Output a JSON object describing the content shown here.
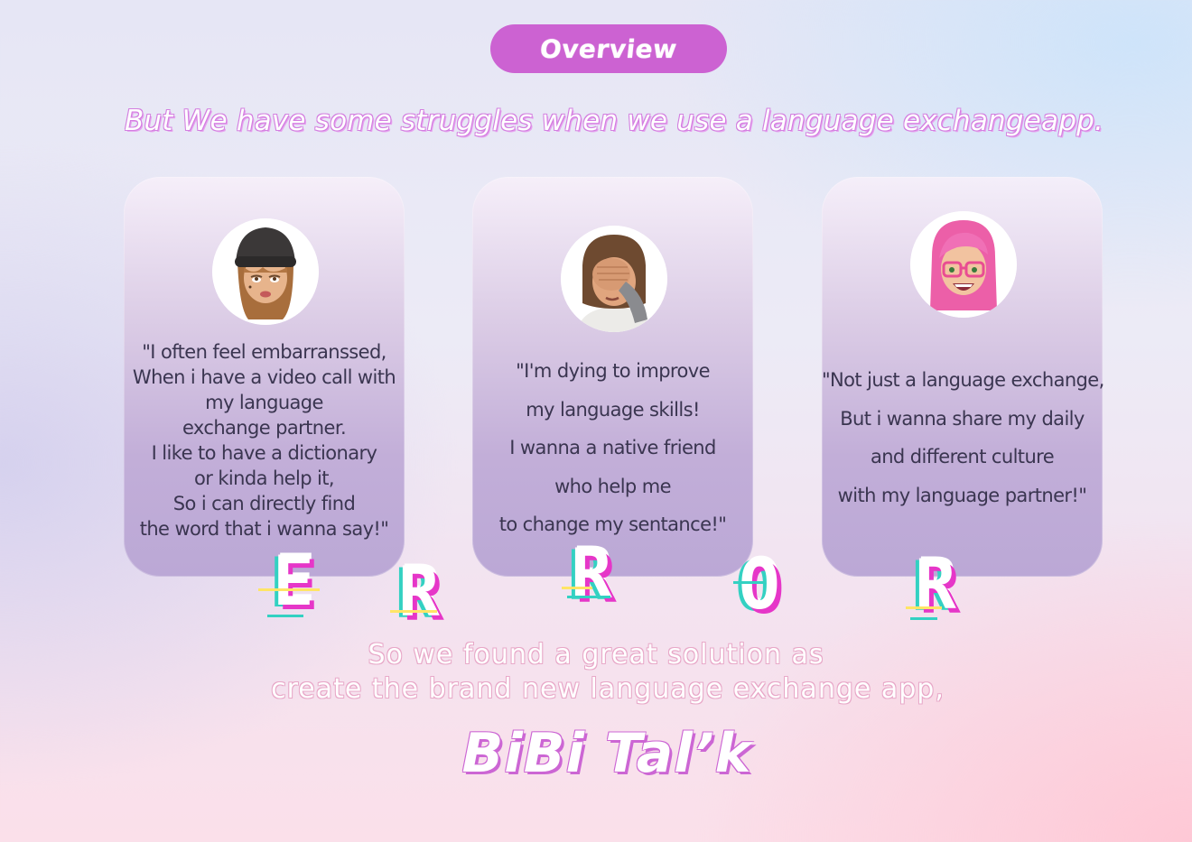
{
  "header": {
    "pill_label": "Overview",
    "headline": "But We have some struggles when we use a language exchangeapp."
  },
  "cards": [
    {
      "avatar_icon": "memoji-beanie-girl-icon",
      "quote_lines": [
        "\"I often feel embarranssed,",
        "When i have a video call with",
        "my language",
        "exchange partner.",
        "I like to have a dictionary",
        "or kinda help it,",
        "So i can directly find",
        "the word that i  wanna say!\""
      ]
    },
    {
      "avatar_icon": "memoji-facepalm-icon",
      "quote_lines": [
        "\"I'm dying to improve",
        "my language skills!",
        "I wanna a native friend",
        "who help me",
        "to change my sentance!\""
      ]
    },
    {
      "avatar_icon": "memoji-pink-hair-glasses-icon",
      "quote_lines": [
        "\"Not just a language exchange,",
        "But i wanna share my daily",
        "and different culture",
        "with my language partner!\""
      ]
    }
  ],
  "error_letters": [
    "E",
    "R",
    "R",
    "O",
    "R"
  ],
  "solution": {
    "line1": "So we found a great solution as",
    "line2": "create the brand new language exchange app,",
    "brand": "BiBi Tal’k"
  },
  "colors": {
    "pill": "#cc62d2",
    "glitch_magenta": "#e636c8",
    "glitch_cyan": "#33d1c2",
    "glitch_yellow": "#ffe566",
    "card_text": "#3a3550"
  }
}
